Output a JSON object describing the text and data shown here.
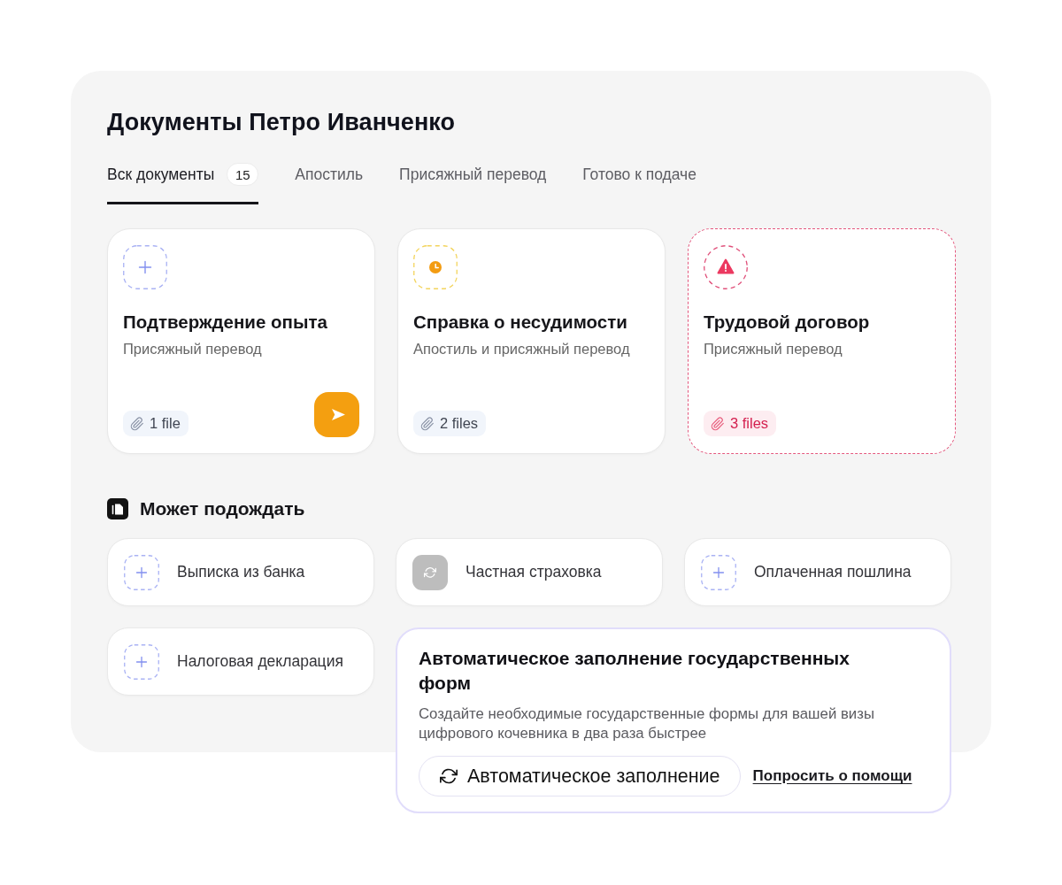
{
  "title": "Документы Петро Иванченко",
  "tabs": [
    {
      "label": "Вск документы",
      "count": "15",
      "selected": true
    },
    {
      "label": "Апостиль",
      "selected": false
    },
    {
      "label": "Присяжный перевод",
      "selected": false
    },
    {
      "label": "Готово к подаче",
      "selected": false
    }
  ],
  "documents": [
    {
      "kind": "missing",
      "title": "Подтверждение опыта",
      "subtitle": "Присяжный перевод",
      "files": "1 file",
      "send_button": true
    },
    {
      "kind": "pending",
      "title": "Справка о несудимости",
      "subtitle": "Апостиль и присяжный перевод",
      "files": "2 files",
      "send_button": false
    },
    {
      "kind": "error",
      "title": "Трудовой договор",
      "subtitle": "Присяжный перевод",
      "files": "3 files",
      "send_button": false
    }
  ],
  "waiting_section": {
    "title": "Может подождать",
    "items": [
      {
        "kind": "missing",
        "label": "Выписка из банка"
      },
      {
        "kind": "syncing",
        "label": "Частная страховка"
      },
      {
        "kind": "missing",
        "label": "Оплаченная пошлина"
      },
      {
        "kind": "missing",
        "label": "Налоговая декларация"
      }
    ]
  },
  "autofill_card": {
    "title": "Автоматическое заполнение государственных форм",
    "description": "Создайте необходимые государственные формы для вашей визы цифрового кочевника в два раза быстрее",
    "button": "Автоматическое заполнение",
    "link": "Попросить о помощи"
  }
}
